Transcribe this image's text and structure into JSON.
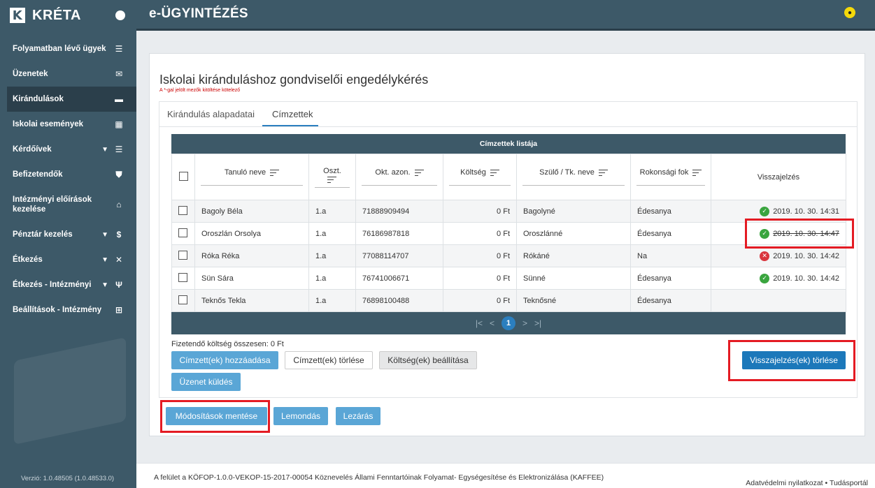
{
  "app": {
    "name": "KRÉTA",
    "section_title": "e-ÜGYINTÉZÉS"
  },
  "sidebar": {
    "items": [
      {
        "label": "Folyamatban lévő ügyek",
        "icon": "list-icon",
        "glyph": "☰"
      },
      {
        "label": "Üzenetek",
        "icon": "mail-icon",
        "glyph": "✉"
      },
      {
        "label": "Kirándulások",
        "icon": "bed-icon",
        "glyph": "▬"
      },
      {
        "label": "Iskolai események",
        "icon": "calendar-icon",
        "glyph": "▦"
      },
      {
        "label": "Kérdőívek",
        "icon": "list-icon",
        "glyph": "☰"
      },
      {
        "label": "Befizetendők",
        "icon": "stamp-icon",
        "glyph": "⛊"
      },
      {
        "label": "Intézményi előírások kezelése",
        "icon": "bank-icon",
        "glyph": "⌂"
      },
      {
        "label": "Pénztár kezelés",
        "icon": "dollar-icon",
        "glyph": "$"
      },
      {
        "label": "Étkezés",
        "icon": "utensils-icon",
        "glyph": "✕"
      },
      {
        "label": "Étkezés - Intézményi",
        "icon": "fork-icon",
        "glyph": "Ψ"
      },
      {
        "label": "Beállítások - Intézmény",
        "icon": "plus-square-icon",
        "glyph": "⊞"
      }
    ],
    "version": "Verzió: 1.0.48505 (1.0.48533.0)"
  },
  "page": {
    "title": "Iskolai kiránduláshoz gondviselői engedélykérés",
    "required_note": "A *-gal jelölt mezők kitöltése kötelező",
    "tabs": [
      "Kirándulás alapadatai",
      "Címzettek"
    ]
  },
  "table": {
    "title": "Címzettek listája",
    "headers": {
      "name": "Tanuló neve",
      "class": "Oszt.",
      "id": "Okt. azon.",
      "cost": "Költség",
      "parent": "Szülő / Tk. neve",
      "relation": "Rokonsági fok",
      "feedback": "Visszajelzés"
    },
    "rows": [
      {
        "name": "Bagoly Béla",
        "class": "1.a",
        "id": "71888909494",
        "cost": "0 Ft",
        "parent": "Bagolyné",
        "relation": "Édesanya",
        "feedback": "2019. 10. 30. 14:31"
      },
      {
        "name": "Oroszlán Orsolya",
        "class": "1.a",
        "id": "76186987818",
        "cost": "0 Ft",
        "parent": "Oroszlánné",
        "relation": "Édesanya",
        "feedback": "2019. 10. 30. 14:47"
      },
      {
        "name": "Róka Réka",
        "class": "1.a",
        "id": "77088114707",
        "cost": "0 Ft",
        "parent": "Rókáné",
        "relation": "Na",
        "feedback": "2019. 10. 30. 14:42"
      },
      {
        "name": "Sün Sára",
        "class": "1.a",
        "id": "76741006671",
        "cost": "0 Ft",
        "parent": "Sünné",
        "relation": "Édesanya",
        "feedback": "2019. 10. 30. 14:42"
      },
      {
        "name": "Teknős Tekla",
        "class": "1.a",
        "id": "76898100488",
        "cost": "0 Ft",
        "parent": "Teknősné",
        "relation": "Édesanya",
        "feedback": ""
      }
    ],
    "pager": {
      "first": "|<",
      "prev": "<",
      "page": "1",
      "next": ">",
      "last": ">|"
    }
  },
  "summary": {
    "total_cost": "Fizetendő költség összesen: 0 Ft"
  },
  "buttons": {
    "add_recipient": "Címzett(ek) hozzáadása",
    "delete_recipient": "Címzett(ek) törlése",
    "set_cost": "Költség(ek) beállítása",
    "send_message": "Üzenet küldés",
    "delete_feedback": "Visszajelzés(ek) törlése",
    "save_changes": "Módosítások mentése",
    "cancel": "Lemondás",
    "close": "Lezárás"
  },
  "footer": {
    "text": "A felület a KÖFOP-1.0.0-VEKOP-15-2017-00054 Köznevelés Állami Fenntartóinak Folyamat- Egységesítése és Elektronizálása (KAFFEE)",
    "privacy": "Adatvédelmi nyilatkozat",
    "separator": "•",
    "knowledge": "Tudásportál"
  },
  "colors": {
    "sidebar": "#3d5968",
    "accent": "#1c78ba",
    "button": "#5aa6d6",
    "highlight": "#e41b23"
  }
}
